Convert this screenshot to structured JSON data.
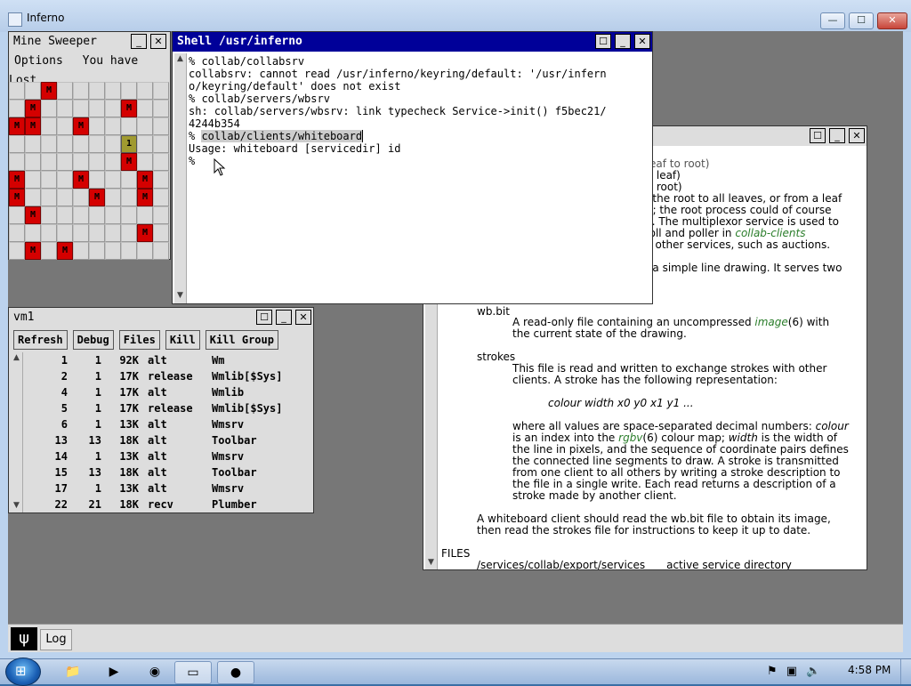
{
  "outer_window": {
    "title": "Inferno",
    "min": "—",
    "max": "☐",
    "close": "✕"
  },
  "minesweeper": {
    "title": "Mine Sweeper",
    "menu_options": "Options",
    "status": "You have Lost",
    "rows": [
      "..M.......",
      ".M.....M..",
      "MM..M.....",
      ".......1..",
      ".......M..",
      "M...M...M.",
      "M....M..M.",
      ".M........",
      "........M.",
      ".M.M......"
    ]
  },
  "shell": {
    "title": "Shell /usr/inferno",
    "lines": [
      "% collab/collabsrv",
      "collabsrv: cannot read /usr/inferno/keyring/default: '/usr/infern",
      "o/keyring/default' does not exist",
      "% collab/servers/wbsrv",
      "sh: collab/servers/wbsrv: link typecheck Service->init() f5bec21/",
      "4244b354"
    ],
    "selected_line_prompt": "% ",
    "selected_line_cmd": "collab/clients/whiteboard",
    "usage": "Usage: whiteboard [servicedir] id",
    "prompt": "%"
  },
  "help": {
    "clip_top": "(leaf to root)",
    "frag1": "to leaf)",
    "frag2": "to root)",
    "frag3": "n the root to all leaves, or from a leaf",
    "frag4": "af; the root process could of course",
    "frag5": "af. The multiplexor service is used to",
    "frag6a": "poll and poller in ",
    "frag6b": "collab-clients",
    "frag7": "al other services, such as auctions.",
    "frag8": "g a simple line drawing. It serves two",
    "wbbit_name": "wb.bit",
    "wbbit_d1a": "A read-only file containing an uncompressed ",
    "wbbit_link": "image",
    "wbbit_d1b": "(6) with",
    "wbbit_d2": "the current state of the drawing.",
    "strokes_name": "strokes",
    "strokes_d1": "This file is read and written to exchange strokes with other",
    "strokes_d2": "clients. A stroke has the following representation:",
    "repr": "colour width x0 y0 x1 y1 ...",
    "p1a": "where all values are space-separated decimal numbers: ",
    "p1b": "colour",
    "p2a": "is an index into the ",
    "p2link": "rgbv",
    "p2b": "(6) colour map; ",
    "p2c": "width",
    "p2d": " is the width of",
    "p3": "the line in pixels, and the sequence of coordinate pairs defines",
    "p4": "the connected line segments to draw. A stroke is transmitted",
    "p5": "from one client to all others by writing a stroke description to",
    "p6": "the file in a single write. Each read returns a description of a",
    "p7": "stroke made by another client.",
    "q1": "A whiteboard client should read the  wb.bit file to obtain its image,",
    "q2": "then read the  strokes file for instructions to keep it up to date.",
    "files_heading": "FILES",
    "files_path": "/services/collab/export/services",
    "files_desc": "active service directory"
  },
  "vm": {
    "title": "vm1",
    "buttons": [
      "Refresh",
      "Debug",
      "Files",
      "Kill",
      "Kill Group"
    ],
    "rows": [
      [
        "1",
        "1",
        "92K",
        "alt",
        "Wm"
      ],
      [
        "2",
        "1",
        "17K",
        "release",
        "Wmlib[$Sys]"
      ],
      [
        "4",
        "1",
        "17K",
        "alt",
        "Wmlib"
      ],
      [
        "5",
        "1",
        "17K",
        "release",
        "Wmlib[$Sys]"
      ],
      [
        "6",
        "1",
        "13K",
        "alt",
        "Wmsrv"
      ],
      [
        "13",
        "13",
        "18K",
        "alt",
        "Toolbar"
      ],
      [
        "14",
        "1",
        "13K",
        "alt",
        "Wmsrv"
      ],
      [
        "15",
        "13",
        "18K",
        "alt",
        "Toolbar"
      ],
      [
        "17",
        "1",
        "13K",
        "alt",
        "Wmsrv"
      ],
      [
        "22",
        "21",
        "18K",
        "recv",
        "Plumber"
      ]
    ]
  },
  "logbar": {
    "log_label": "Log"
  },
  "taskbar": {
    "clock": "4:58 PM"
  },
  "colors": {
    "inferno_bg": "#777777",
    "active_title": "#000099",
    "mine": "#d40000",
    "link": "#2a7d2a"
  }
}
